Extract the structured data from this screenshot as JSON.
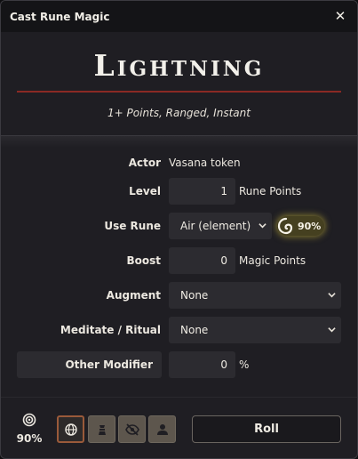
{
  "window": {
    "title": "Cast Rune Magic",
    "close_label": "✕"
  },
  "spell": {
    "name": "Lightning",
    "subtitle": "1+ Points, Ranged, Instant"
  },
  "form": {
    "actor": {
      "label": "Actor",
      "value": "Vasana token"
    },
    "level": {
      "label": "Level",
      "value": "1",
      "unit": "Rune Points"
    },
    "use_rune": {
      "label": "Use Rune",
      "value": "Air (element)",
      "chance": "90%"
    },
    "boost": {
      "label": "Boost",
      "value": "0",
      "unit": "Magic Points"
    },
    "augment": {
      "label": "Augment",
      "value": "None"
    },
    "meditate": {
      "label": "Meditate / Ritual",
      "value": "None"
    },
    "other_modifier": {
      "label": "Other Modifier",
      "value": "0",
      "unit": "%"
    }
  },
  "footer": {
    "target_percent": "90%",
    "visibility_buttons": [
      {
        "icon": "globe-icon",
        "active": true
      },
      {
        "icon": "gm-icon",
        "active": false
      },
      {
        "icon": "eye-slash-icon",
        "active": false
      },
      {
        "icon": "user-icon",
        "active": false
      }
    ],
    "roll_label": "Roll"
  },
  "colors": {
    "accent_red": "#8b2a24",
    "rune_glow": "#dcc83c",
    "active_border": "#9a5a3a"
  }
}
